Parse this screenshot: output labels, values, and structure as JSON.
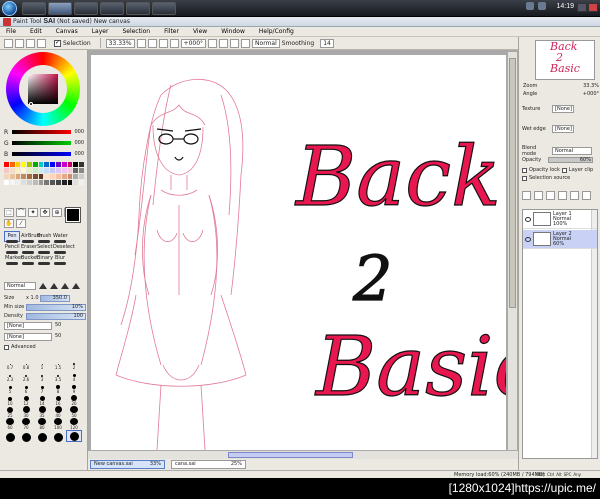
{
  "taskbar": {
    "clock": "14:19"
  },
  "window": {
    "title_tag": "(Not saved)",
    "title_doc": "New canvas",
    "app_name": "SAI",
    "title_prefix": "Paint Tool"
  },
  "menu": [
    "File",
    "Edit",
    "Canvas",
    "Layer",
    "Selection",
    "Filter",
    "View",
    "Window",
    "Help/Config"
  ],
  "toolbar": {
    "selection_label": "Selection",
    "zoom": "33.33%",
    "rotation": "+000°",
    "blend": "Normal",
    "smoothing_label": "Smoothing",
    "smoothing_value": "14"
  },
  "color": {
    "r_label": "R",
    "r_value": "000",
    "g_label": "G",
    "g_value": "000",
    "b_label": "B",
    "b_value": "000",
    "fg": "#000000",
    "bg": "#ffffff"
  },
  "swatch_colors": [
    "#ff0000",
    "#ff6600",
    "#ffcc00",
    "#ffff00",
    "#99cc00",
    "#00aa00",
    "#00cccc",
    "#0066cc",
    "#0000ff",
    "#6600cc",
    "#cc00cc",
    "#cc0066",
    "#000000",
    "#333333",
    "#f7c6c6",
    "#f7dcc6",
    "#f7efc6",
    "#fafad2",
    "#e3f0c6",
    "#c6efc6",
    "#c6eeee",
    "#c6dcf7",
    "#c6c6f7",
    "#dcc6f7",
    "#f0c6f0",
    "#f7c6dc",
    "#666666",
    "#888888",
    "#f2d6bc",
    "#e8c29d",
    "#d9a77a",
    "#c48b5e",
    "#a66d44",
    "#7f4f2d",
    "#5e3a21",
    "#ffe4d1",
    "#ffd4b8",
    "#f5c1a0",
    "#e3a988",
    "#cc8f70",
    "#aaaaaa",
    "#cccccc",
    "#ffffff",
    "#f5f5f5",
    "#eeeeee",
    "#dddddd",
    "#cfcfcf",
    "#bbbbbb",
    "#999999",
    "#777777",
    "#555555",
    "#444444",
    "#222222",
    "#111111",
    "#e0e0e0",
    "#f0f0f0"
  ],
  "tools": {
    "brushes": [
      {
        "label": "Pen",
        "active": true
      },
      {
        "label": "AirBrush",
        "active": false
      },
      {
        "label": "Brush",
        "active": false
      },
      {
        "label": "Water",
        "active": false
      },
      {
        "label": "",
        "active": false
      },
      {
        "label": "Pencil",
        "active": false
      },
      {
        "label": "Eraser",
        "active": false
      },
      {
        "label": "Select",
        "active": false
      },
      {
        "label": "Deselect",
        "active": false
      },
      {
        "label": "",
        "active": false
      },
      {
        "label": "Marker",
        "active": false
      },
      {
        "label": "Bucket",
        "active": false
      },
      {
        "label": "Binary",
        "active": false
      },
      {
        "label": "Blur",
        "active": false
      },
      {
        "label": "",
        "active": false
      }
    ]
  },
  "brush_settings": {
    "mode": "Normal",
    "size_label": "Size",
    "size_mult": "x 1.0",
    "size_value": "350.0",
    "min_size_label": "Min size",
    "min_size_value": "10%",
    "density_label": "Density",
    "density_value": "100",
    "texture_1": "[None]",
    "texture_1_value": "50",
    "texture_2": "[None]",
    "texture_2_value": "50",
    "advanced_label": "Advanced"
  },
  "size_presets": [
    {
      "label": "0.7",
      "d": 1
    },
    {
      "label": "0.8",
      "d": 1
    },
    {
      "label": "1",
      "d": 1
    },
    {
      "label": "1.5",
      "d": 1
    },
    {
      "label": "2",
      "d": 2
    },
    {
      "label": "2.3",
      "d": 2
    },
    {
      "label": "2.6",
      "d": 2
    },
    {
      "label": "3",
      "d": 2
    },
    {
      "label": "3.5",
      "d": 2
    },
    {
      "label": "4",
      "d": 3
    },
    {
      "label": "5",
      "d": 3
    },
    {
      "label": "6",
      "d": 3
    },
    {
      "label": "7",
      "d": 3
    },
    {
      "label": "8",
      "d": 4
    },
    {
      "label": "9",
      "d": 4
    },
    {
      "label": "10",
      "d": 4
    },
    {
      "label": "12",
      "d": 5
    },
    {
      "label": "14",
      "d": 5
    },
    {
      "label": "16",
      "d": 5
    },
    {
      "label": "20",
      "d": 6
    },
    {
      "label": "25",
      "d": 6
    },
    {
      "label": "30",
      "d": 7
    },
    {
      "label": "35",
      "d": 7
    },
    {
      "label": "40",
      "d": 7
    },
    {
      "label": "50",
      "d": 8
    },
    {
      "label": "60",
      "d": 8
    },
    {
      "label": "70",
      "d": 8
    },
    {
      "label": "80",
      "d": 8
    },
    {
      "label": "100",
      "d": 8
    },
    {
      "label": "120",
      "d": 8
    },
    {
      "label": "",
      "d": 9
    },
    {
      "label": "",
      "d": 9
    },
    {
      "label": "",
      "d": 9
    },
    {
      "label": "",
      "d": 9
    },
    {
      "label": "",
      "d": 9
    }
  ],
  "canvas": {
    "art_lines": [
      "Back",
      "2",
      "Basic"
    ],
    "black": "#111111",
    "red": "#e8174f",
    "sketch": "#e27a95"
  },
  "navigator": {
    "zoom_label": "Zoom",
    "zoom_value": "33.3%",
    "angle_label": "Angle",
    "angle_value": "+000°"
  },
  "layer_props": {
    "texture_label": "Texture",
    "texture_value": "[None]",
    "wet_edge_label": "Wet edge",
    "wet_edge_value": "[None]",
    "blend_label": "Blend mode",
    "blend_value": "Normal",
    "opacity_label": "Opacity",
    "opacity_value": "60%",
    "opacity_lock": "Opacity lock",
    "layer_clip": "Layer clip",
    "selection_source": "Selection source"
  },
  "layers": [
    {
      "name": "Layer 1",
      "mode": "Normal",
      "opacity": "100%",
      "active": false
    },
    {
      "name": "Layer 2",
      "mode": "Normal",
      "opacity": "60%",
      "active": true
    }
  ],
  "tabs": [
    {
      "name": "New canvas.sai",
      "zoom": "33%",
      "active": true
    },
    {
      "name": "cana.sai",
      "zoom": "25%",
      "active": false
    }
  ],
  "status": {
    "memory": "Memory load:60% (240MB / 794MB)",
    "tray": [
      "Shift",
      "Ctrl",
      "Alt",
      "SPC",
      "Any"
    ]
  },
  "watermark": "[1280x1024]https://upic.me/"
}
